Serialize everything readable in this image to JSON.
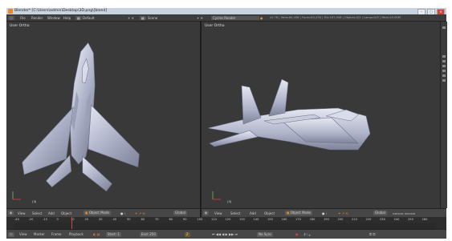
{
  "window": {
    "title": "Blender* [C:\\Users\\admin\\Desktop\\3D.png\\[blend]",
    "controls": [
      "–",
      "□",
      "×"
    ]
  },
  "menubar": {
    "items": [
      "File",
      "Render",
      "Window",
      "Help"
    ],
    "layout": "Default",
    "scene": "Scene",
    "engine": "Cycles Render",
    "stats": "v2.78 | Verts:84,436 | Faces:83,478 | Tris:167,008 | Objects:0/2 | Lamps:0/0 | Mem:43.00M"
  },
  "viewports": {
    "left": {
      "label": "User Ortho",
      "object": "(3)"
    },
    "right": {
      "label": "User Ortho",
      "object": "(3)"
    }
  },
  "view3d_header": {
    "menus": [
      "View",
      "Select",
      "Add",
      "Object"
    ],
    "mode": "Object Mode",
    "orientation": "Global"
  },
  "timeline": {
    "ticks": [
      "-40",
      "-20",
      "-10",
      "0",
      "10",
      "20",
      "30",
      "40",
      "50",
      "60",
      "70",
      "80",
      "90",
      "100",
      "110",
      "120",
      "130",
      "140",
      "150",
      "160",
      "170",
      "180",
      "190",
      "200",
      "210",
      "220",
      "230",
      "240",
      "250",
      "260"
    ],
    "menus": [
      "View",
      "Marker",
      "Frame",
      "Playback"
    ],
    "start_label": "Start:",
    "start": "1",
    "end_label": "End:",
    "end": "250",
    "current": "2",
    "sync": "No Sync"
  },
  "colors": {
    "accent": "#e8872a",
    "viewport": "#393939",
    "header": "#464646",
    "aircraft": "#c4c8dc"
  }
}
